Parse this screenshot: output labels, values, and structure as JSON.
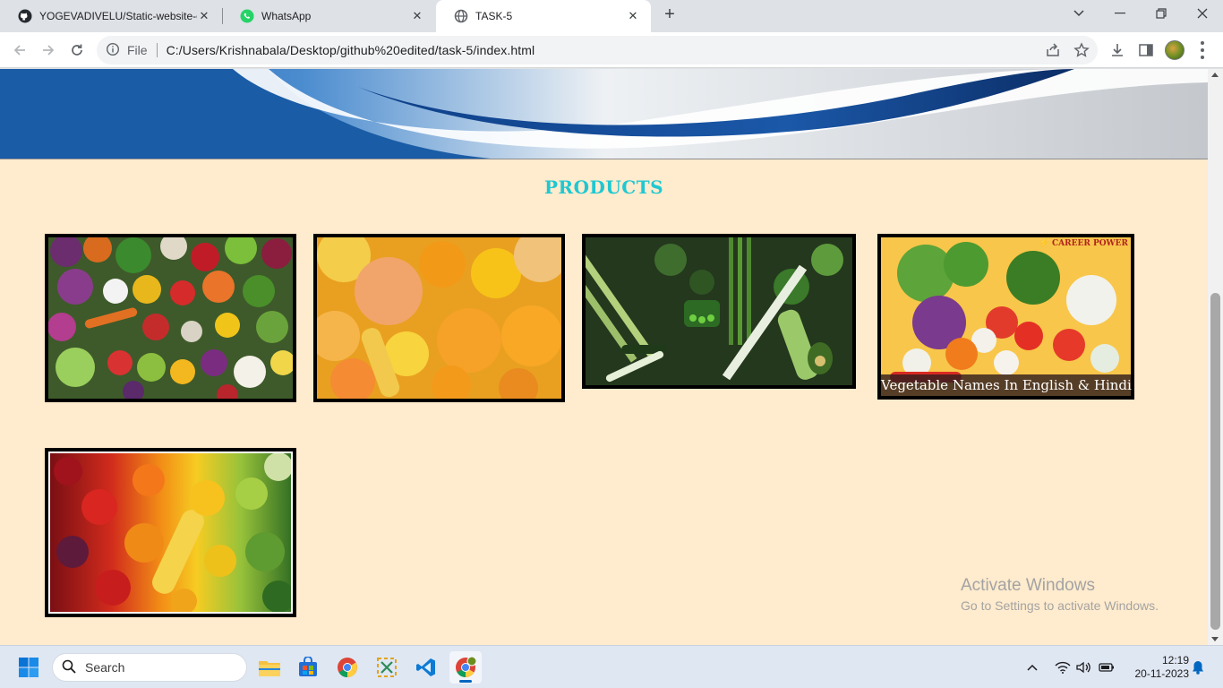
{
  "browser": {
    "tabs": [
      {
        "title": "YOGEVADIVELU/Static-website-c",
        "icon": "github-icon",
        "active": false
      },
      {
        "title": "WhatsApp",
        "icon": "whatsapp-icon",
        "active": false
      },
      {
        "title": "TASK-5",
        "icon": "globe-icon",
        "active": true
      }
    ],
    "omnibox": {
      "scheme_label": "File",
      "url": "C:/Users/Krishnabala/Desktop/github%20edited/task-5/index.html"
    }
  },
  "page": {
    "section_title": "PRODUCTS",
    "products": [
      {
        "name": "mixed-vegetables-image",
        "caption": "",
        "brand": ""
      },
      {
        "name": "orange-produce-image",
        "caption": "",
        "brand": ""
      },
      {
        "name": "green-vegetables-image",
        "caption": "",
        "brand": ""
      },
      {
        "name": "vegetable-names-image",
        "caption": "Vegetable Names In English & Hindi",
        "brand": "⚡ CAREER POWER"
      },
      {
        "name": "rainbow-produce-image",
        "caption": "",
        "brand": ""
      }
    ]
  },
  "watermark": {
    "line1": "Activate Windows",
    "line2": "Go to Settings to activate Windows."
  },
  "taskbar": {
    "search_placeholder": "Search",
    "time": "12:19",
    "date": "20-11-2023"
  },
  "colors": {
    "page_background": "#ffebcd",
    "title_color": "#1ec8d2"
  }
}
